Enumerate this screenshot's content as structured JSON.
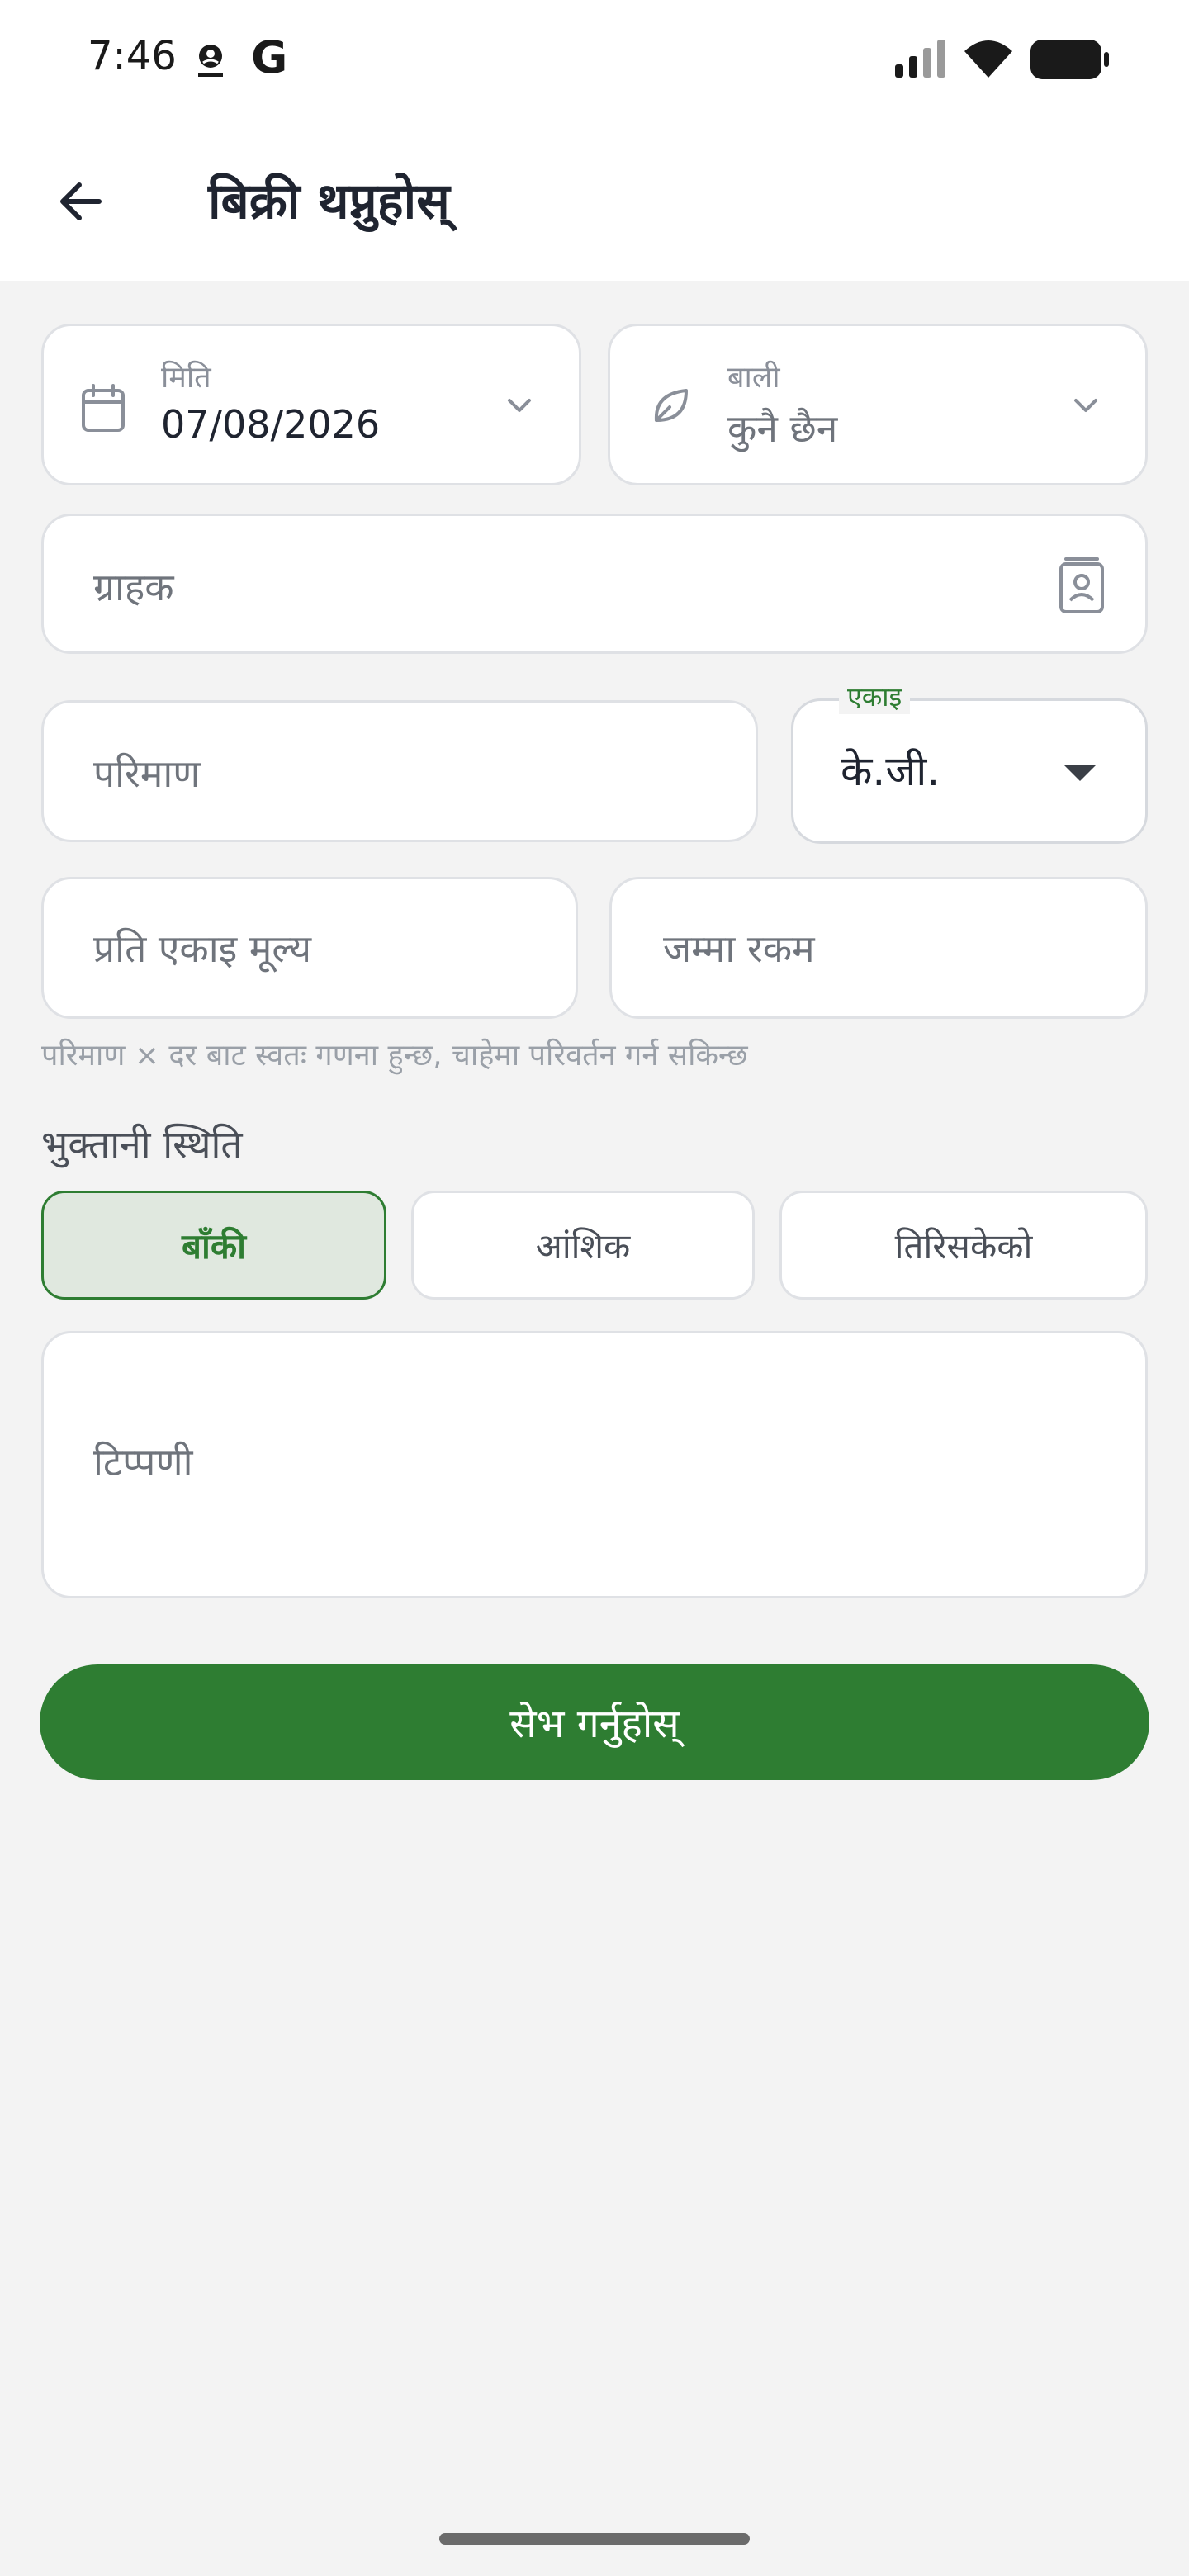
{
  "status_bar": {
    "time": "7:46",
    "google_glyph": "G",
    "icons": [
      "app-notification-icon",
      "google-icon",
      "signal-icon",
      "wifi-icon",
      "battery-icon"
    ]
  },
  "header": {
    "title": "बिक्री थप्नुहोस्",
    "back_icon": "arrow-left-icon"
  },
  "form": {
    "date": {
      "label": "मिति",
      "value": "07/08/2026",
      "icon": "calendar-icon"
    },
    "crop": {
      "label": "बाली",
      "value": "कुनै छैन",
      "icon": "leaf-icon"
    },
    "customer": {
      "placeholder": "ग्राहक",
      "icon": "contact-book-icon"
    },
    "quantity": {
      "placeholder": "परिमाण"
    },
    "unit": {
      "label": "एकाइ",
      "value": "के.जी."
    },
    "unit_price": {
      "placeholder": "प्रति एकाइ मूल्य"
    },
    "total_amount": {
      "placeholder": "जम्मा रकम"
    },
    "hint": "परिमाण × दर बाट स्वतः गणना हुन्छ, चाहेमा परिवर्तन गर्न सकिन्छ",
    "payment_status": {
      "label": "भुक्तानी स्थिति",
      "options": [
        "बाँकी",
        "आंशिक",
        "तिरिसकेको"
      ],
      "selected": "बाँकी"
    },
    "note": {
      "placeholder": "टिप्पणी"
    }
  },
  "save_button": {
    "label": "सेभ गर्नुहोस्"
  },
  "colors": {
    "primary": "#2e7d32",
    "selected_bg": "#e0e8df",
    "background": "#f3f3f3",
    "surface": "#ffffff",
    "border": "#dfe1e5"
  }
}
